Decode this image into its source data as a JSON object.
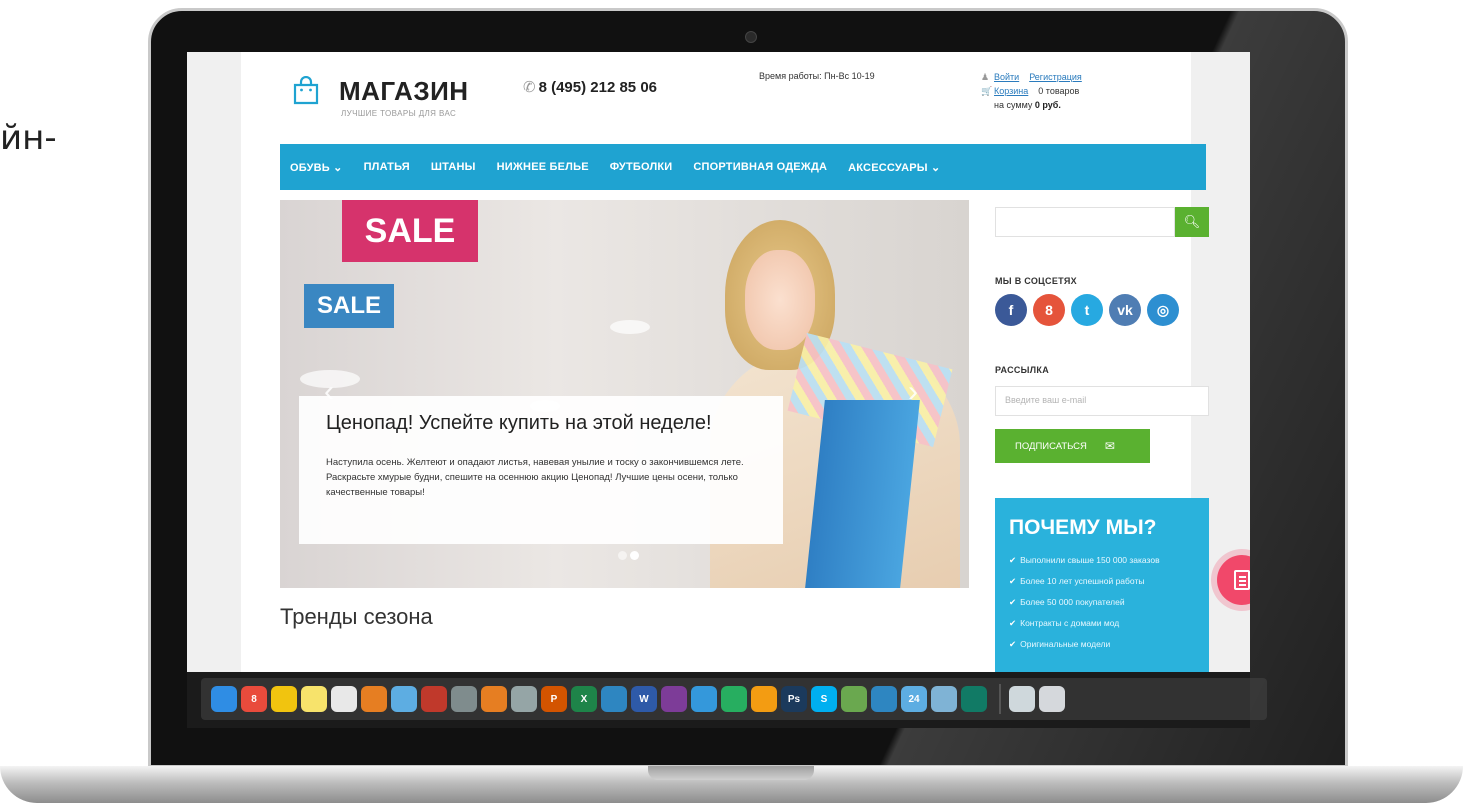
{
  "edge_text": "йн-",
  "site": {
    "logo_name": "МАГАЗИН",
    "logo_tagline": "ЛУЧШИЕ ТОВАРЫ ДЛЯ ВАС",
    "phone": "8 (495) 212 85 06",
    "hours": "Время работы: Пн-Вс 10-19",
    "account": {
      "login": "Войти",
      "register": "Регистрация",
      "cart": "Корзина",
      "cart_count": "0 товаров",
      "cart_sum_label": "на сумму",
      "cart_sum": "0 руб."
    },
    "nav": [
      "ОБУВЬ ⌄",
      "ПЛАТЬЯ",
      "ШТАНЫ",
      "НИЖНЕЕ БЕЛЬЕ",
      "ФУТБОЛКИ",
      "СПОРТИВНАЯ ОДЕЖДА",
      "АКСЕССУАРЫ ⌄"
    ],
    "slider": {
      "sale_big": "SALE",
      "sale_small": "SALE",
      "title": "Ценопад! Успейте купить на этой неделе!",
      "text": "Наступила осень. Желтеют и опадают листья, навевая унылие и тоску о закончившемся лете. Раскрасьте хмурые будни, спешите на осеннюю акцию Ценопад! Лучшие цены осени, только качественные товары!",
      "prev": "‹",
      "next": "›",
      "active_slide": 2,
      "slide_count": 2
    },
    "trends_title": "Тренды сезона",
    "sidebar": {
      "search_placeholder": "",
      "social_heading": "МЫ В СОЦСЕТЯХ",
      "social": [
        {
          "name": "facebook-icon",
          "glyph": "f",
          "color": "#3b5998"
        },
        {
          "name": "google-plus-icon",
          "glyph": "8",
          "color": "#e5543b"
        },
        {
          "name": "twitter-icon",
          "glyph": "t",
          "color": "#27a9e1"
        },
        {
          "name": "vk-icon",
          "glyph": "vk",
          "color": "#4f7db3"
        },
        {
          "name": "instagram-icon",
          "glyph": "◎",
          "color": "#2d8fd1"
        }
      ],
      "newsletter_heading": "РАССЫЛКА",
      "email_placeholder": "Введите ваш e-mail",
      "subscribe_label": "ПОДПИСАТЬСЯ",
      "why_title": "ПОЧЕМУ МЫ?",
      "why_items": [
        "Выполнили свыше 150 000 заказов",
        "Более 10 лет успешной работы",
        "Более 50 000 покупателей",
        "Контракты с домами мод",
        "Оригинальные модели"
      ]
    }
  },
  "dock": {
    "apps": [
      {
        "name": "finder-icon",
        "label": "",
        "color": "#2f8de4"
      },
      {
        "name": "calendar-icon",
        "label": "8",
        "color": "#e94b3c"
      },
      {
        "name": "notes-icon",
        "label": "",
        "color": "#f1c40f"
      },
      {
        "name": "stickies-icon",
        "label": "",
        "color": "#f7e36b"
      },
      {
        "name": "reminders-icon",
        "label": "",
        "color": "#e8e8e8"
      },
      {
        "name": "photos-icon",
        "label": "",
        "color": "#e67e22"
      },
      {
        "name": "preview-icon",
        "label": "",
        "color": "#5dade2"
      },
      {
        "name": "itunes-icon",
        "label": "",
        "color": "#c0392b"
      },
      {
        "name": "system-preferences-icon",
        "label": "",
        "color": "#7f8c8d"
      },
      {
        "name": "ibooks-icon",
        "label": "",
        "color": "#e67e22"
      },
      {
        "name": "launchpad-icon",
        "label": "",
        "color": "#95a5a6"
      },
      {
        "name": "powerpoint-icon",
        "label": "P",
        "color": "#d35400"
      },
      {
        "name": "excel-icon",
        "label": "X",
        "color": "#1e8449"
      },
      {
        "name": "telegram-icon",
        "label": "",
        "color": "#2e86c1"
      },
      {
        "name": "word-icon",
        "label": "W",
        "color": "#2e5aa8"
      },
      {
        "name": "viber-icon",
        "label": "",
        "color": "#7d3c98"
      },
      {
        "name": "safari-icon",
        "label": "",
        "color": "#3498db"
      },
      {
        "name": "chrome-icon",
        "label": "",
        "color": "#27ae60"
      },
      {
        "name": "sketch-icon",
        "label": "",
        "color": "#f39c12"
      },
      {
        "name": "photoshop-icon",
        "label": "Ps",
        "color": "#1b3a5c"
      },
      {
        "name": "skype-icon",
        "label": "S",
        "color": "#00aff0"
      },
      {
        "name": "utorrent-icon",
        "label": "",
        "color": "#6aa84f"
      },
      {
        "name": "quicktime-icon",
        "label": "",
        "color": "#2e86c1"
      },
      {
        "name": "activity-monitor-icon",
        "label": "24",
        "color": "#5dade2"
      },
      {
        "name": "image-capture-icon",
        "label": "",
        "color": "#7fb3d5"
      },
      {
        "name": "edge-icon",
        "label": "",
        "color": "#117a65"
      }
    ],
    "extras": [
      {
        "name": "downloads-stack-icon",
        "label": "",
        "color": "#cfd8dc"
      },
      {
        "name": "trash-icon",
        "label": "",
        "color": "#d5d8dc"
      }
    ]
  }
}
